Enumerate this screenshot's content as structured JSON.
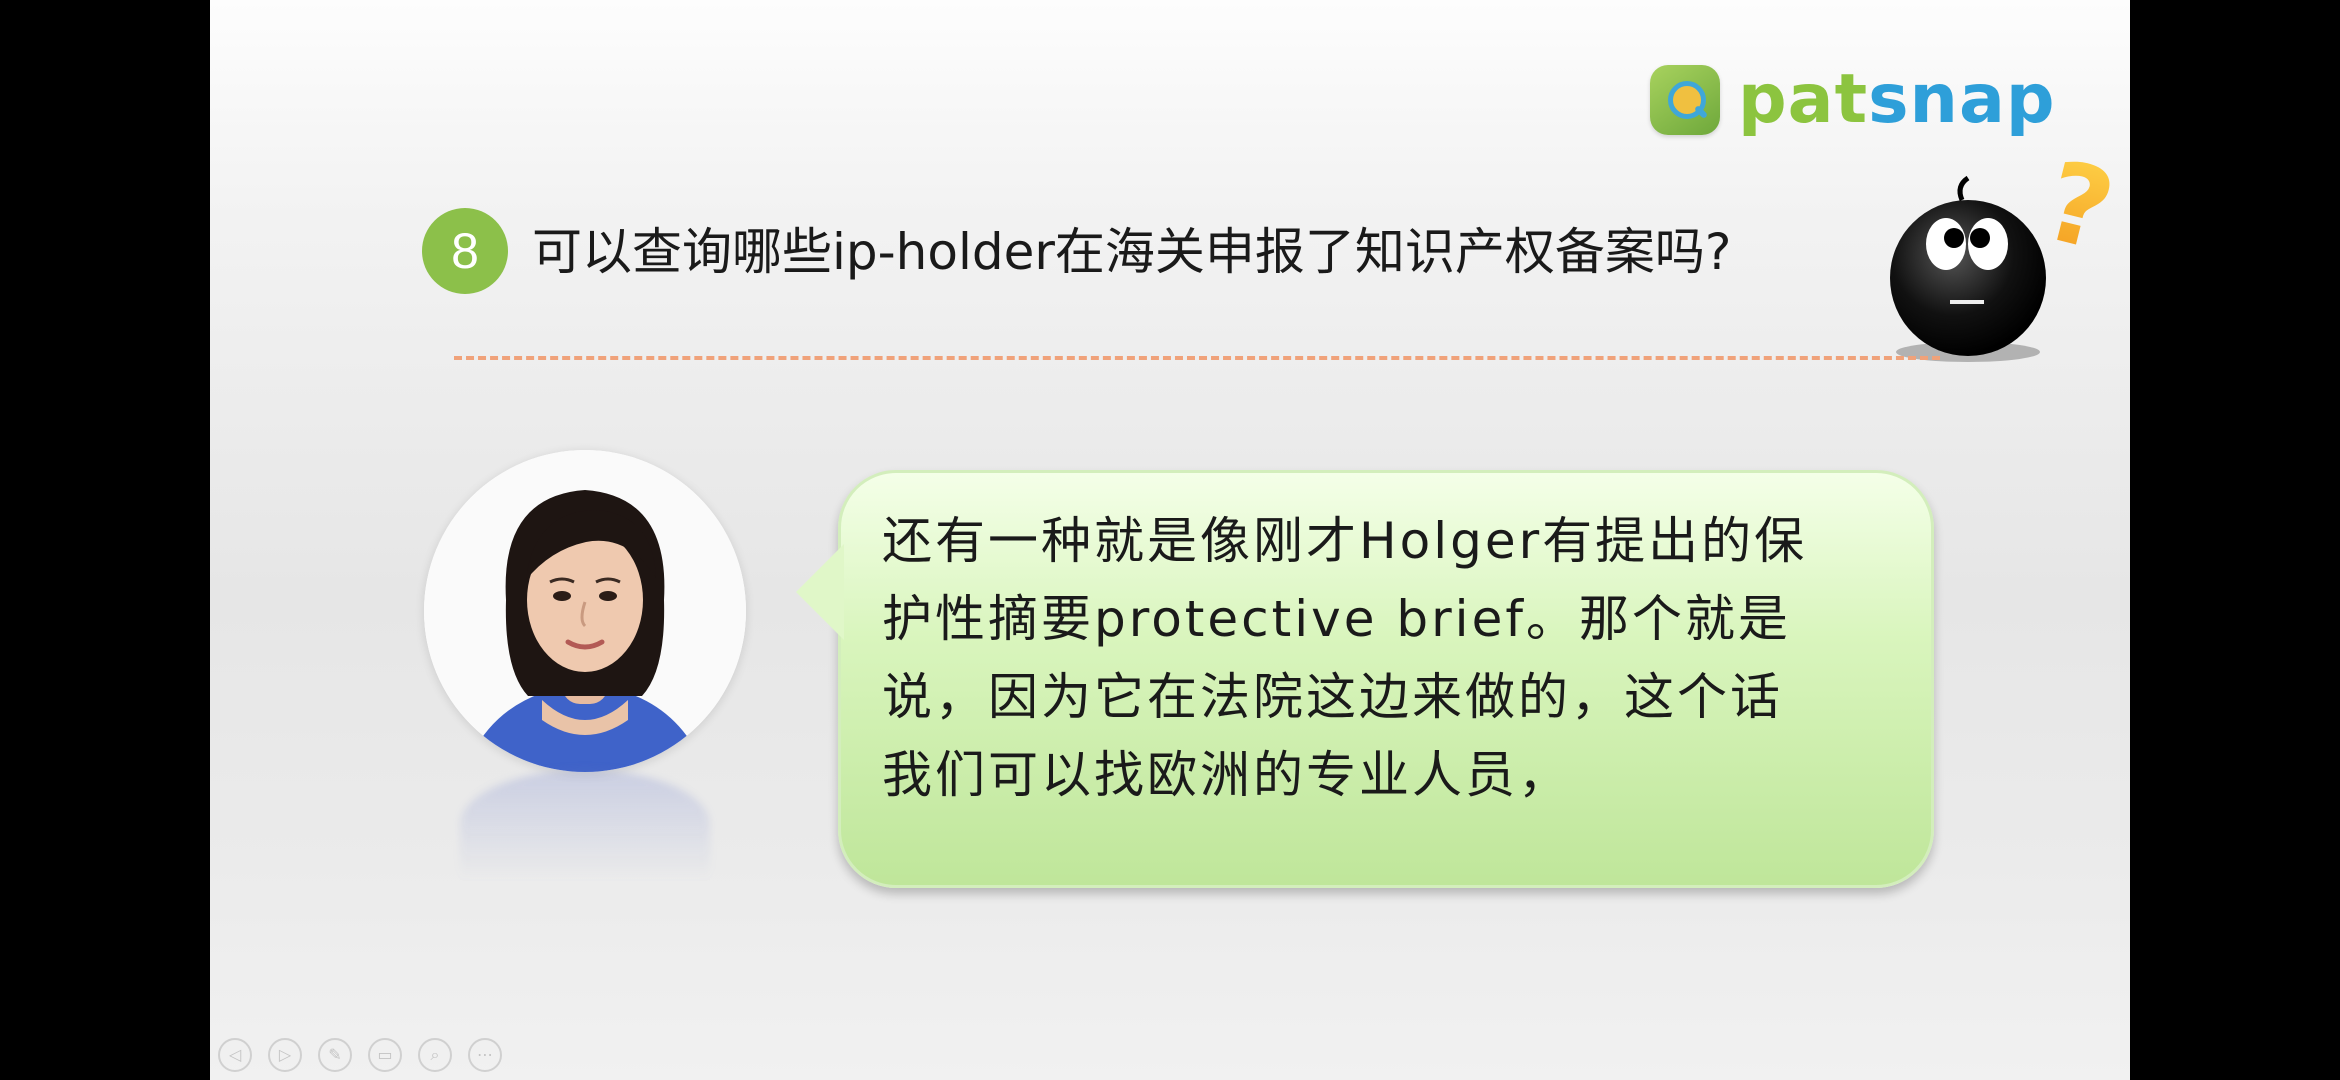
{
  "logo": {
    "text_part1": "pat",
    "text_part2": "snap"
  },
  "question": {
    "number": "8",
    "text": "可以查询哪些ip-holder在海关申报了知识产权备案吗?"
  },
  "bubble": {
    "text": "还有一种就是像刚才Holger有提出的保\n护性摘要protective brief。那个就是\n说，因为它在法院这边来做的，这个话\n我们可以找欧洲的专业人员，"
  },
  "mascot": {
    "icon": "question-mark-icon",
    "mark": "?"
  },
  "toolbar": {
    "icons": [
      "back-icon",
      "forward-icon",
      "pen-icon",
      "slides-icon",
      "zoom-icon",
      "more-icon"
    ],
    "glyphs": [
      "◁",
      "▷",
      "✎",
      "▭",
      "⌕",
      "⋯"
    ]
  },
  "colors": {
    "accent_green": "#8cc04a",
    "brand_blue": "#2e9fd9",
    "divider_orange": "#f0a27a",
    "bubble_green": "#d9f5bd"
  }
}
